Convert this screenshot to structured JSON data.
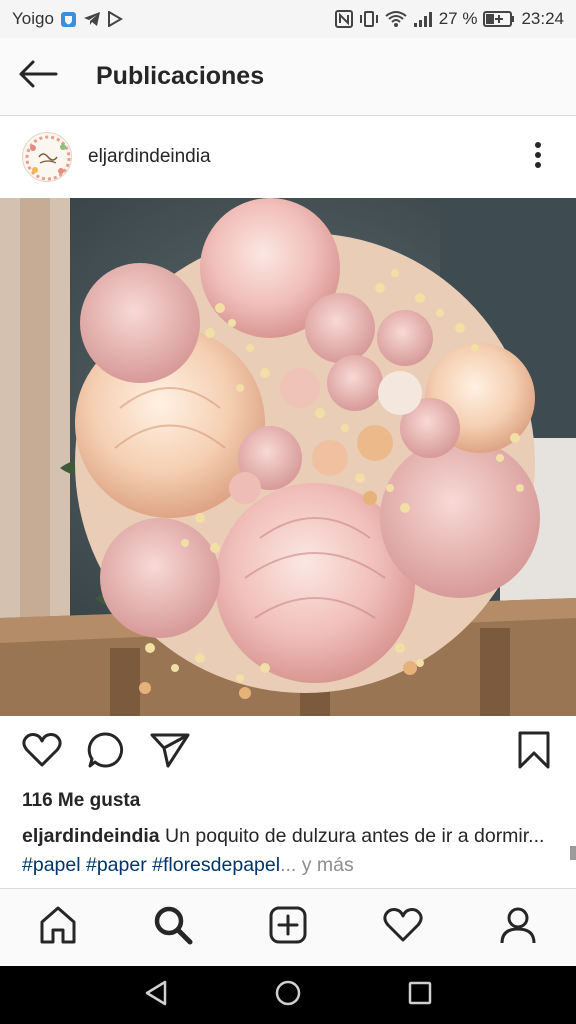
{
  "status_bar": {
    "carrier": "Yoigo",
    "battery_percent": "27 %",
    "time": "23:24"
  },
  "header": {
    "title": "Publicaciones"
  },
  "post": {
    "username": "eljardindeindia",
    "likes": "116 Me gusta",
    "caption": {
      "username": "eljardindeindia",
      "text": "Un poquito de dulzura antes de ir a dormir...",
      "hashtags": [
        "#papel",
        "#paper",
        "#floresdepapel"
      ],
      "ellipsis": "...",
      "more": "y más"
    }
  },
  "icons": {
    "back": "arrow-left-icon",
    "more": "more-vertical-icon",
    "like": "heart-icon",
    "comment": "comment-icon",
    "share": "send-icon",
    "save": "bookmark-icon",
    "home": "home-icon",
    "search": "search-icon",
    "add": "add-post-icon",
    "activity": "heart-icon",
    "profile": "profile-icon"
  },
  "colors": {
    "hashtag": "#003569",
    "more_text": "#8e8e8e",
    "text": "#262626"
  }
}
